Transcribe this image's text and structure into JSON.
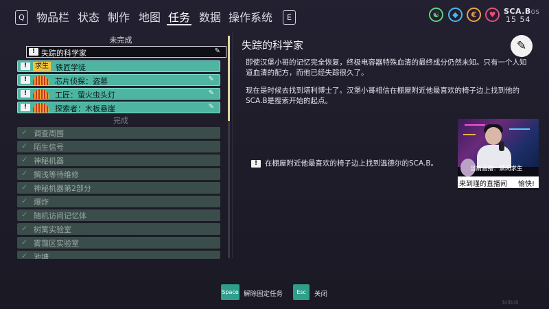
{
  "topbar": {
    "left_key": "Q",
    "right_key": "E",
    "tabs": [
      {
        "label": "物品栏"
      },
      {
        "label": "状态"
      },
      {
        "label": "制作"
      },
      {
        "label": "地图"
      },
      {
        "label": "任务"
      },
      {
        "label": "数据"
      },
      {
        "label": "操作系统"
      }
    ],
    "active_tab": "任务",
    "stats": [
      {
        "icon": "stamina-icon",
        "glyph": "☯",
        "color": "#5fd37a"
      },
      {
        "icon": "water-icon",
        "glyph": "💧",
        "color": "#4fb6e8"
      },
      {
        "icon": "food-icon",
        "glyph": "€",
        "color": "#f2a24a"
      },
      {
        "icon": "health-icon",
        "glyph": "♥",
        "color": "#e8507a"
      }
    ],
    "device": "SCA.B",
    "device_suffix": "OS",
    "time": "15 54"
  },
  "quests": {
    "incomplete_header": "未完成",
    "selected": {
      "label": "失踪的科学家",
      "marker": "!"
    },
    "active": [
      {
        "label": "铁匠学徒",
        "tag": "求生"
      },
      {
        "label": "芯片侦探：盗墓",
        "icon": "heat-icon",
        "pinned": true
      },
      {
        "label": "工匠：萤火虫头灯",
        "icon": "heat-icon",
        "pinned": true
      },
      {
        "label": "探索者：木板悬崖",
        "icon": "heat-icon",
        "pinned": true
      }
    ],
    "completed_header": "完成",
    "completed": [
      "调查周围",
      "陌生信号",
      "神秘机器",
      "搁浅等待维修",
      "神秘机器第2部分",
      "爆炸",
      "随机访问记忆体",
      "树篱实验室",
      "雾霭区实验室",
      "池塘"
    ]
  },
  "detail": {
    "title": "失踪的科学家",
    "paragraph1": "即使汉堡小哥的记忆完全恢复，终极电容器特殊血清的最终成分仍然未知。只有一个人知道血清的配方，而他已经失踪很久了。",
    "paragraph2": "现在是时候去找到塔利博士了。汉堡小哥相信在棚屋附近他最喜欢的椅子边上找到他的SCA.B是搜索开始的起点。",
    "objective": "在棚屋附近他最喜欢的椅子边上找到温德尔的SCA.B。"
  },
  "stream": {
    "now_playing": "当前直播：禁闭求生",
    "bar_left": "来到瑾的直播间",
    "bar_right": "愉快!"
  },
  "footer": {
    "pin_key": "Space",
    "pin_label": "解除固定任务",
    "close_key": "Esc",
    "close_label": "关闭",
    "watermark": "bilibili"
  }
}
